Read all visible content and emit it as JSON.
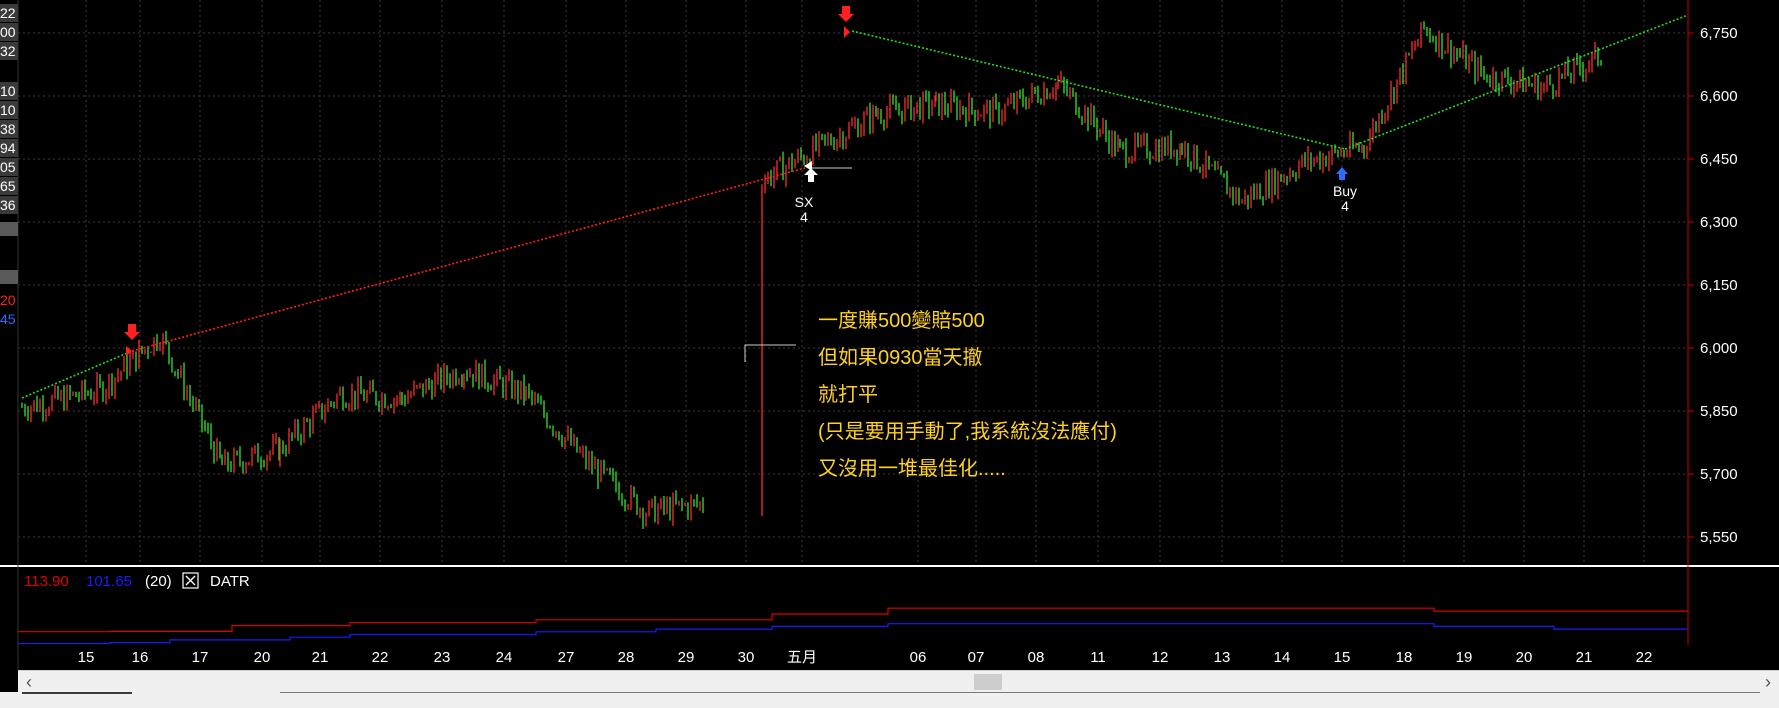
{
  "left_panel_values": [
    "22",
    "00",
    "32",
    "10",
    "10",
    "38",
    "94",
    "05",
    "65",
    "36",
    "20",
    "45"
  ],
  "price_axis": {
    "ticks": [
      "6,750",
      "6,600",
      "6,450",
      "6,300",
      "6,150",
      "6,000",
      "5,850",
      "5,700",
      "5,550"
    ]
  },
  "indicator": {
    "value_red": "113.90",
    "value_blue": "101.65",
    "period": "(20)",
    "name": "DATR"
  },
  "annotation_lines": [
    "一度賺500變賠500",
    "但如果0930當天撤",
    "就打平",
    "(只是要用手動了,我系統沒法應付)",
    "又沒用一堆最佳化....."
  ],
  "signals": {
    "sx": {
      "label": "SX",
      "qty": "4"
    },
    "buy": {
      "label": "Buy",
      "qty": "4"
    }
  },
  "colors": {
    "up": "#ff2a2a",
    "down": "#2ee62e",
    "red_line": "#ff2020",
    "green_line": "#22dd22",
    "indicator_red": "#e00000",
    "indicator_blue": "#1a1aff",
    "annotation": "#ffd21f",
    "grid": "#3a3a3a"
  },
  "chart_data": {
    "type": "line",
    "title": "",
    "price_range": [
      5500,
      6850
    ],
    "x": [
      "15",
      "16",
      "17",
      "20",
      "21",
      "22",
      "23",
      "24",
      "27",
      "28",
      "29",
      "30",
      "五月",
      "06",
      "07",
      "08",
      "11",
      "12",
      "13",
      "14",
      "15",
      "18",
      "19",
      "20",
      "21",
      "22"
    ],
    "series": [
      {
        "values": [
          5870,
          5900,
          6030,
          5720,
          5760,
          5890,
          5880,
          5950,
          5890,
          5730,
          5610,
          5630,
          6400,
          6560,
          6580,
          6560,
          6630,
          6470,
          6480,
          6350,
          6440,
          6480,
          6760,
          6650,
          6620,
          6700
        ]
      }
    ],
    "indicator_series": [
      {
        "values": [
          113.9,
          114,
          114,
          116,
          116,
          117,
          117,
          117,
          118,
          118,
          118,
          118,
          120,
          122,
          122,
          122,
          122,
          122,
          122,
          122,
          122,
          122,
          121,
          121,
          121,
          121
        ]
      },
      {
        "values": [
          101.65,
          102,
          103,
          103,
          104,
          105,
          105,
          105,
          106,
          106,
          107,
          107,
          108,
          109,
          109,
          109,
          109,
          109,
          109,
          109,
          109,
          109,
          108,
          108,
          107,
          107
        ]
      }
    ]
  }
}
